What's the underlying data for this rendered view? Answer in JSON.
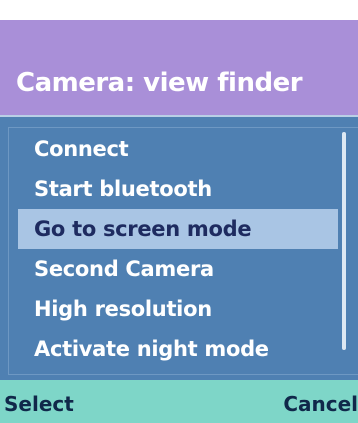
{
  "title": "Camera: view finder",
  "menu": {
    "items": [
      {
        "label": "Connect"
      },
      {
        "label": "Start bluetooth"
      },
      {
        "label": "Go to screen mode"
      },
      {
        "label": "Second Camera"
      },
      {
        "label": "High resolution"
      },
      {
        "label": "Activate night mode"
      }
    ],
    "selected_index": 2
  },
  "softkeys": {
    "left": "Select",
    "right": "Cancel"
  },
  "colors": {
    "title_bar": "#a98fd8",
    "menu_background": "#4f80b2",
    "selection_highlight": "#a9c5e4",
    "softkey_bar": "#7ed6c8"
  }
}
